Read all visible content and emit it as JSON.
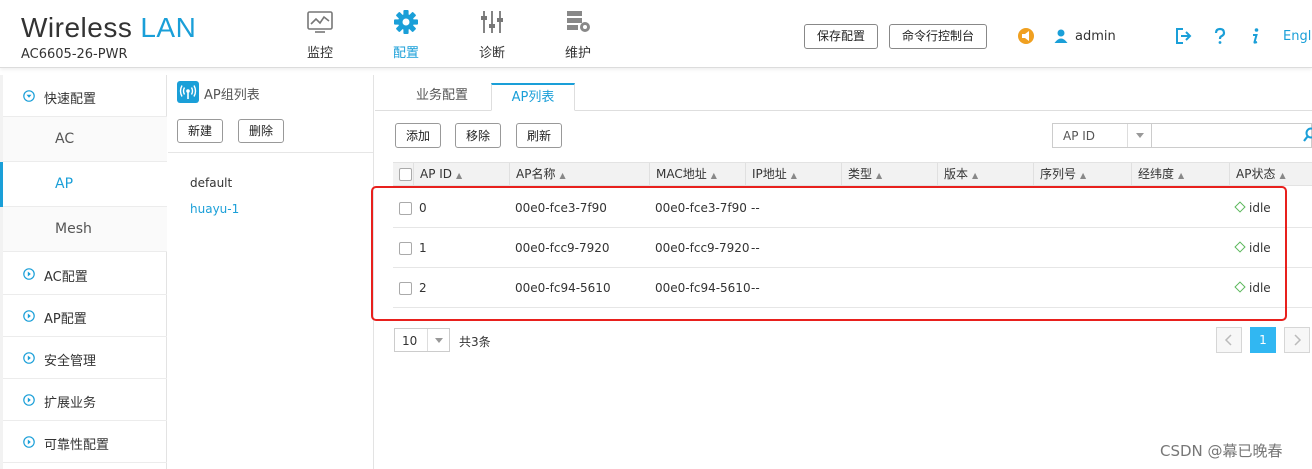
{
  "header": {
    "brand_wireless": "Wireless",
    "brand_lan": "LAN",
    "model": "AC6605-26-PWR",
    "nav": [
      {
        "label": "监控",
        "icon": "monitor-icon"
      },
      {
        "label": "配置",
        "icon": "gear-icon"
      },
      {
        "label": "诊断",
        "icon": "sliders-icon"
      },
      {
        "label": "维护",
        "icon": "maintenance-icon"
      }
    ],
    "save_config": "保存配置",
    "cli_console": "命令行控制台",
    "user": "admin",
    "language": "Engli"
  },
  "sidebar": {
    "quick_config": "快速配置",
    "sub_items": [
      "AC",
      "AP",
      "Mesh"
    ],
    "sections": [
      "AC配置",
      "AP配置",
      "安全管理",
      "扩展业务",
      "可靠性配置"
    ]
  },
  "group_panel": {
    "title": "AP组列表",
    "new_button": "新建",
    "delete_button": "删除",
    "groups": [
      "default",
      "huayu-1"
    ]
  },
  "main": {
    "tabs": [
      "业务配置",
      "AP列表"
    ],
    "toolbar": {
      "add": "添加",
      "remove": "移除",
      "refresh": "刷新"
    },
    "search_field": "AP ID",
    "search_value": "",
    "columns": [
      "AP ID",
      "AP名称",
      "MAC地址",
      "IP地址",
      "类型",
      "版本",
      "序列号",
      "经纬度",
      "AP状态"
    ],
    "rows": [
      {
        "id": "0",
        "name": "00e0-fce3-7f90",
        "mac": "00e0-fce3-7f90",
        "ip": "--",
        "status": "idle"
      },
      {
        "id": "1",
        "name": "00e0-fcc9-7920",
        "mac": "00e0-fcc9-7920",
        "ip": "--",
        "status": "idle"
      },
      {
        "id": "2",
        "name": "00e0-fc94-5610",
        "mac": "00e0-fc94-5610",
        "ip": "--",
        "status": "idle"
      }
    ],
    "page_size": "10",
    "total": "共3条",
    "current_page": "1"
  },
  "watermark": "CSDN @幕已晚春",
  "colors": {
    "accent": "#1a9fd8",
    "highlight": "#e8201d",
    "status_idle": "#5cb85c"
  }
}
